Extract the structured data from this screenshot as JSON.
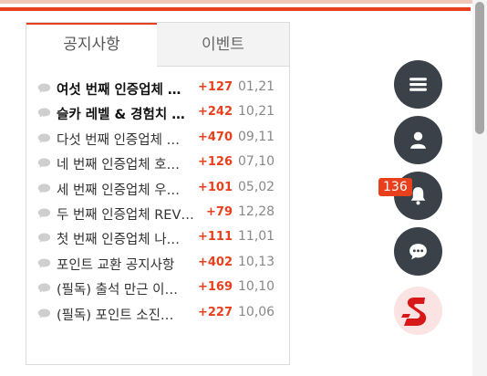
{
  "tabs": {
    "notice": "공지사항",
    "event": "이벤트"
  },
  "notices": [
    {
      "title": "여섯 번째 인증업체 …",
      "points": "+127",
      "date": "01,21",
      "bold": true
    },
    {
      "title": "슬카 레벨 & 경험치 …",
      "points": "+242",
      "date": "10,21",
      "bold": true
    },
    {
      "title": "다섯 번째 인증업체 …",
      "points": "+470",
      "date": "09,11",
      "bold": false
    },
    {
      "title": "네 번째 인증업체 호…",
      "points": "+126",
      "date": "07,10",
      "bold": false
    },
    {
      "title": "세 번째 인증업체 우…",
      "points": "+101",
      "date": "05,02",
      "bold": false
    },
    {
      "title": "두 번째 인증업체 REV…",
      "points": "+79",
      "date": "12,28",
      "bold": false
    },
    {
      "title": "첫 번째 인증업체 나…",
      "points": "+111",
      "date": "11,01",
      "bold": false
    },
    {
      "title": "포인트 교환 공지사항",
      "points": "+402",
      "date": "10,13",
      "bold": false
    },
    {
      "title": "(필독) 출석 만근 이…",
      "points": "+169",
      "date": "10,10",
      "bold": false
    },
    {
      "title": "(필독) 포인트 소진…",
      "points": "+227",
      "date": "10,06",
      "bold": false
    }
  ],
  "notification_count": "136",
  "icons": {
    "menu": "menu-icon",
    "user": "user-icon",
    "bell": "bell-icon",
    "chat": "chat-icon",
    "brand": "s-logo-icon",
    "row": "speech-bubble-icon"
  },
  "colors": {
    "accent": "#e8401c",
    "fab": "#3a4149"
  }
}
